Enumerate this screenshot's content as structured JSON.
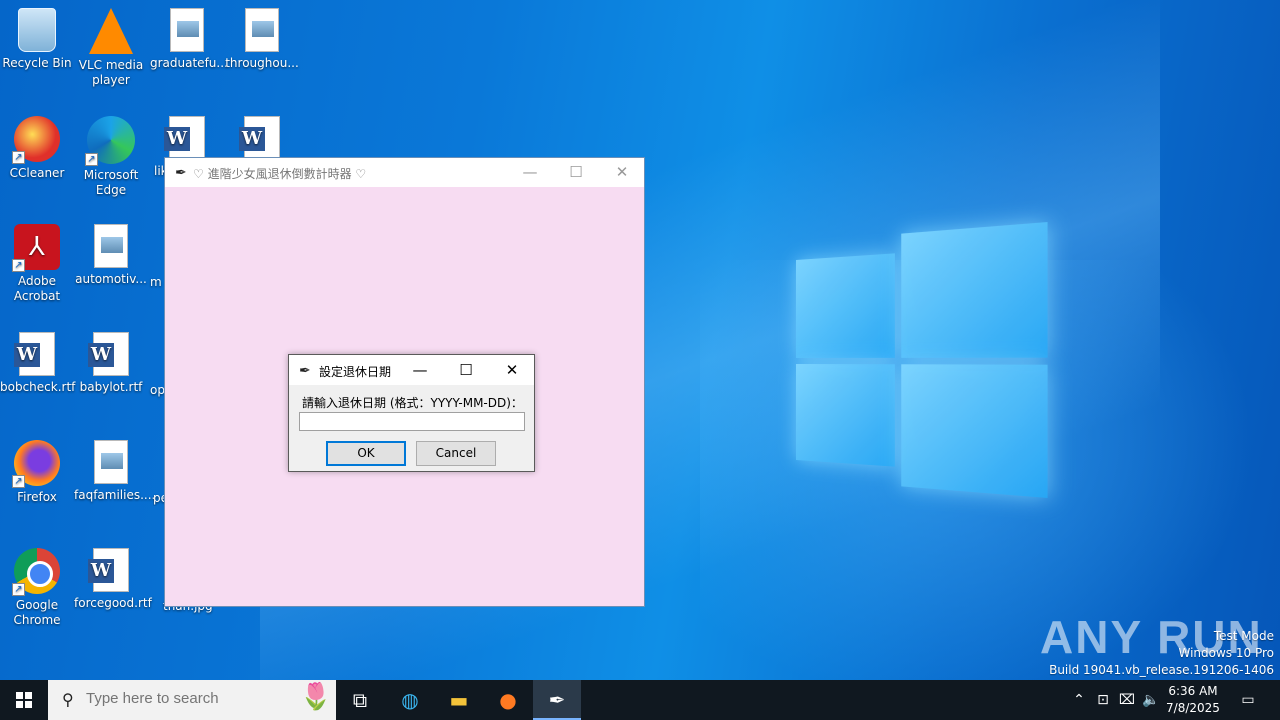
{
  "desktop": {
    "icons": [
      {
        "label": "Recycle Bin"
      },
      {
        "label": "VLC media player"
      },
      {
        "label": "graduatefu..."
      },
      {
        "label": "throughou..."
      },
      {
        "label": "CCleaner"
      },
      {
        "label": "Microsoft Edge"
      },
      {
        "label": "Adobe Acrobat"
      },
      {
        "label": "automotiv..."
      },
      {
        "label": "bobcheck.rtf"
      },
      {
        "label": "babylot.rtf"
      },
      {
        "label": "Firefox"
      },
      {
        "label": "faqfamilies...."
      },
      {
        "label": "Google Chrome"
      },
      {
        "label": "forcegood.rtf"
      }
    ],
    "partial_labels": {
      "li": "lik",
      "m": "m",
      "op": "op",
      "pe": "pe",
      "than": "than.jpg"
    }
  },
  "main_window": {
    "title": "♡ 進階少女風退休倒數計時器 ♡",
    "icon": "tk-feather-icon",
    "background": "#f7dcf2"
  },
  "dialog": {
    "title": "設定退休日期",
    "prompt": "請輸入退休日期 (格式：YYYY-MM-DD)：",
    "entry_value": "",
    "ok_label": "OK",
    "cancel_label": "Cancel"
  },
  "watermark": {
    "brand": "ANY RUN",
    "line1": "Test Mode",
    "line2": "Windows 10 Pro",
    "line3": "Build 19041.vb_release.191206-1406"
  },
  "taskbar": {
    "search_placeholder": "Type here to search",
    "time": "6:36 AM",
    "date": "7/8/2025",
    "pinned": [
      "task-view-icon",
      "edge-icon",
      "file-explorer-icon",
      "firefox-icon",
      "tk-feather-icon"
    ]
  }
}
